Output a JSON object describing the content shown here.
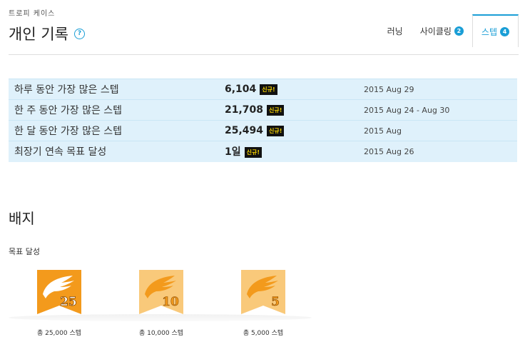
{
  "breadcrumb": "트로피 케이스",
  "page_title": "개인 기록",
  "help_icon": "?",
  "tabs": [
    {
      "label": "러닝",
      "badge": ""
    },
    {
      "label": "사이클링",
      "badge": "2"
    },
    {
      "label": "스텝",
      "badge": "4"
    }
  ],
  "new_tag": "신규!",
  "records": [
    {
      "label": "하루 동안 가장 많은 스텝",
      "value": "6,104",
      "date": "2015 Aug 29"
    },
    {
      "label": "한 주 동안 가장 많은 스텝",
      "value": "21,708",
      "date": "2015 Aug 24 - Aug 30"
    },
    {
      "label": "한 달 동안 가장 많은 스텝",
      "value": "25,494",
      "date": "2015 Aug"
    },
    {
      "label": "최장기 연속 목표 달성",
      "value": "1일",
      "date": "2015 Aug 26"
    }
  ],
  "badges_heading": "배지",
  "goal_section": "목표 달성",
  "badges": [
    {
      "number": "25",
      "caption": "총 25,000 스텝",
      "color": "#f39a1c",
      "icon": "wing-badge-icon"
    },
    {
      "number": "10",
      "caption": "총 10,000 스텝",
      "color": "#f9c97a",
      "icon": "wing-badge-icon"
    },
    {
      "number": "5",
      "caption": "총 5,000 스텝",
      "color": "#f9c97a",
      "icon": "wing-badge-icon"
    }
  ],
  "colors": {
    "accent": "#1a9ed6",
    "row_bg": "#dff1fb",
    "new_bg": "#111111",
    "new_text": "#f5d300"
  }
}
